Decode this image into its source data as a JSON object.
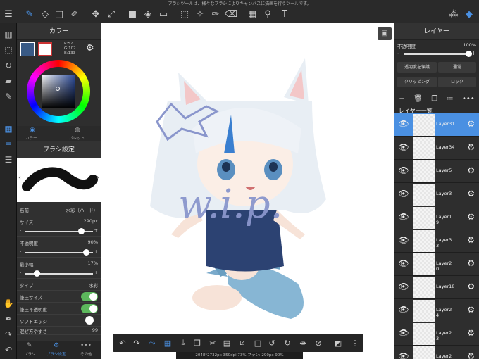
{
  "notice": "ブラシツールは、様々なブラシによりキャンバスに描画を行うツールです。",
  "color_panel": {
    "title": "カラー",
    "r": "R:57",
    "g": "G:102",
    "b": "B:133",
    "tabs": [
      "カラー",
      "パレット"
    ],
    "colors": {
      "main": "#395a85",
      "sub": "#ffffff",
      "accent": "#4a90e2"
    }
  },
  "brush_panel": {
    "title": "ブラシ設定",
    "name_label": "名前",
    "name_value": "水彩（ハード）",
    "size_label": "サイズ",
    "size_value": "290px",
    "size_level": 0.82,
    "opacity_label": "不透明度",
    "opacity_value": "90%",
    "opacity_level": 0.9,
    "min_width_label": "最小幅",
    "min_width_value": "17%",
    "min_width_level": 0.17,
    "type_label": "タイプ",
    "type_value": "水彩",
    "pressure_size_label": "筆圧サイズ",
    "pressure_opacity_label": "筆圧不透明度",
    "soft_edge_label": "ソフトエッジ",
    "blur_label": "混ぜ方やすさ",
    "blur_value": "99",
    "tabs": [
      "ブラシ",
      "ブラシ設定",
      "その他"
    ]
  },
  "layer_panel": {
    "title": "レイヤー",
    "opacity_label": "不透明度",
    "opacity_value": "100%",
    "protect_label": "透明度を保護",
    "blend_label": "通常",
    "clipping_label": "クリッピング",
    "lock_label": "ロック",
    "list_title": "レイヤー一覧",
    "layers": [
      {
        "name": "Layer31",
        "selected": true
      },
      {
        "name": "Layer34",
        "selected": false
      },
      {
        "name": "Layer5",
        "selected": false
      },
      {
        "name": "Layer3",
        "selected": false
      },
      {
        "name": "Layer1\n9",
        "selected": false
      },
      {
        "name": "Layer3\n3",
        "selected": false
      },
      {
        "name": "Layer2\n0",
        "selected": false
      },
      {
        "name": "Layer18",
        "selected": false
      },
      {
        "name": "Layer2\n4",
        "selected": false
      },
      {
        "name": "Layer2\n3",
        "selected": false
      },
      {
        "name": "Layer2",
        "selected": false
      }
    ]
  },
  "status": "2048*2732px 350dpi 73% ブラシ: 290px 90%",
  "canvas_text": "w.i.p."
}
